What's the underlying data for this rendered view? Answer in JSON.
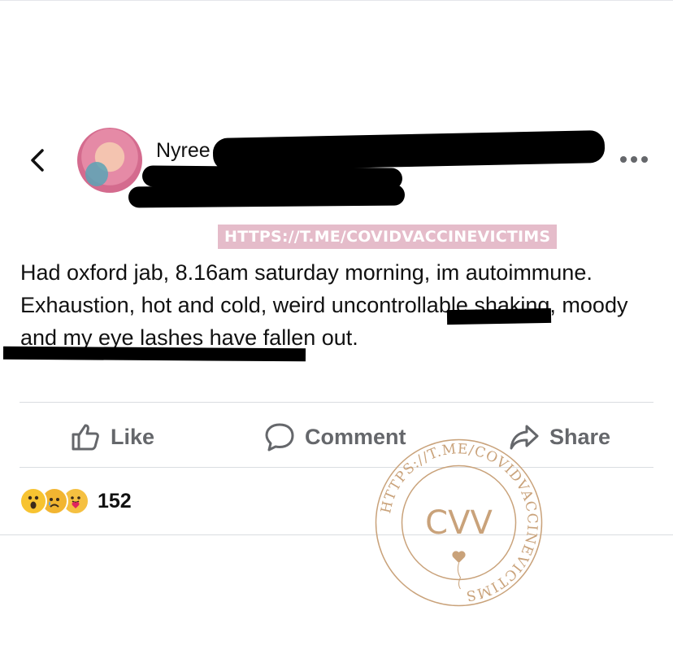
{
  "post": {
    "author": "Nyree M",
    "watermark_url": "HTTPS://T.ME/COVIDVACCINEVICTIMS",
    "body": "Had oxford jab, 8.16am saturday morning, im autoimmune. Exhaustion, hot and cold, weird uncontrollable shaking, moody and my eye lashes have fallen out."
  },
  "actions": {
    "like": "Like",
    "comment": "Comment",
    "share": "Share"
  },
  "reactions": {
    "icons": [
      "wow-reaction-icon",
      "sad-reaction-icon",
      "care-reaction-icon"
    ],
    "count": "152"
  },
  "stamp": {
    "ring_text": "HTTPS://T.ME/COVIDVACCINEVICTIMS",
    "logo": "CVV",
    "color": "#c9a27a"
  },
  "colors": {
    "tag_bg": "#e5bcca",
    "action_gray": "#65676b"
  }
}
